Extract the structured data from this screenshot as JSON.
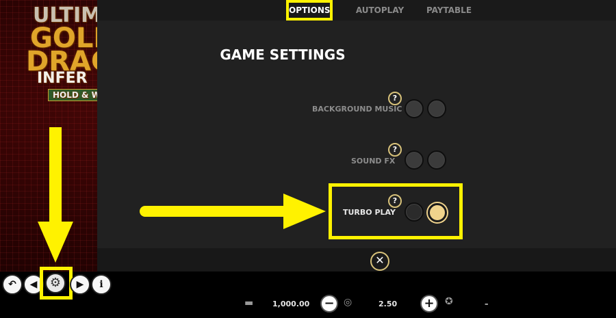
{
  "background": {
    "logo_lines": [
      "ULTIM",
      "GOLD",
      "DRAG",
      "INFER",
      "HOLD & W"
    ]
  },
  "tabs": [
    {
      "label": "OPTIONS",
      "active": true
    },
    {
      "label": "AUTOPLAY",
      "active": false
    },
    {
      "label": "PAYTABLE",
      "active": false
    }
  ],
  "panel": {
    "title": "GAME SETTINGS",
    "settings": [
      {
        "label": "BACKGROUND MUSIC",
        "help": "?",
        "selected": "none"
      },
      {
        "label": "SOUND FX",
        "help": "?",
        "selected": "none"
      },
      {
        "label": "TURBO PLAY",
        "help": "?",
        "selected": "right"
      }
    ],
    "close_icon": "✕"
  },
  "bottom_bar": {
    "buttons": [
      "back-icon",
      "left-icon",
      "gear-icon",
      "right-icon",
      "info-icon"
    ],
    "info_label": "i",
    "balance": "1,000.00",
    "bet": "2.50",
    "win": "–",
    "minus_label": "−",
    "plus_label": "+"
  },
  "colors": {
    "annotation_yellow": "#fff200",
    "panel_bg": "#212121",
    "toggle_on": "#f0d38c",
    "help_ring": "#d8c27a"
  }
}
